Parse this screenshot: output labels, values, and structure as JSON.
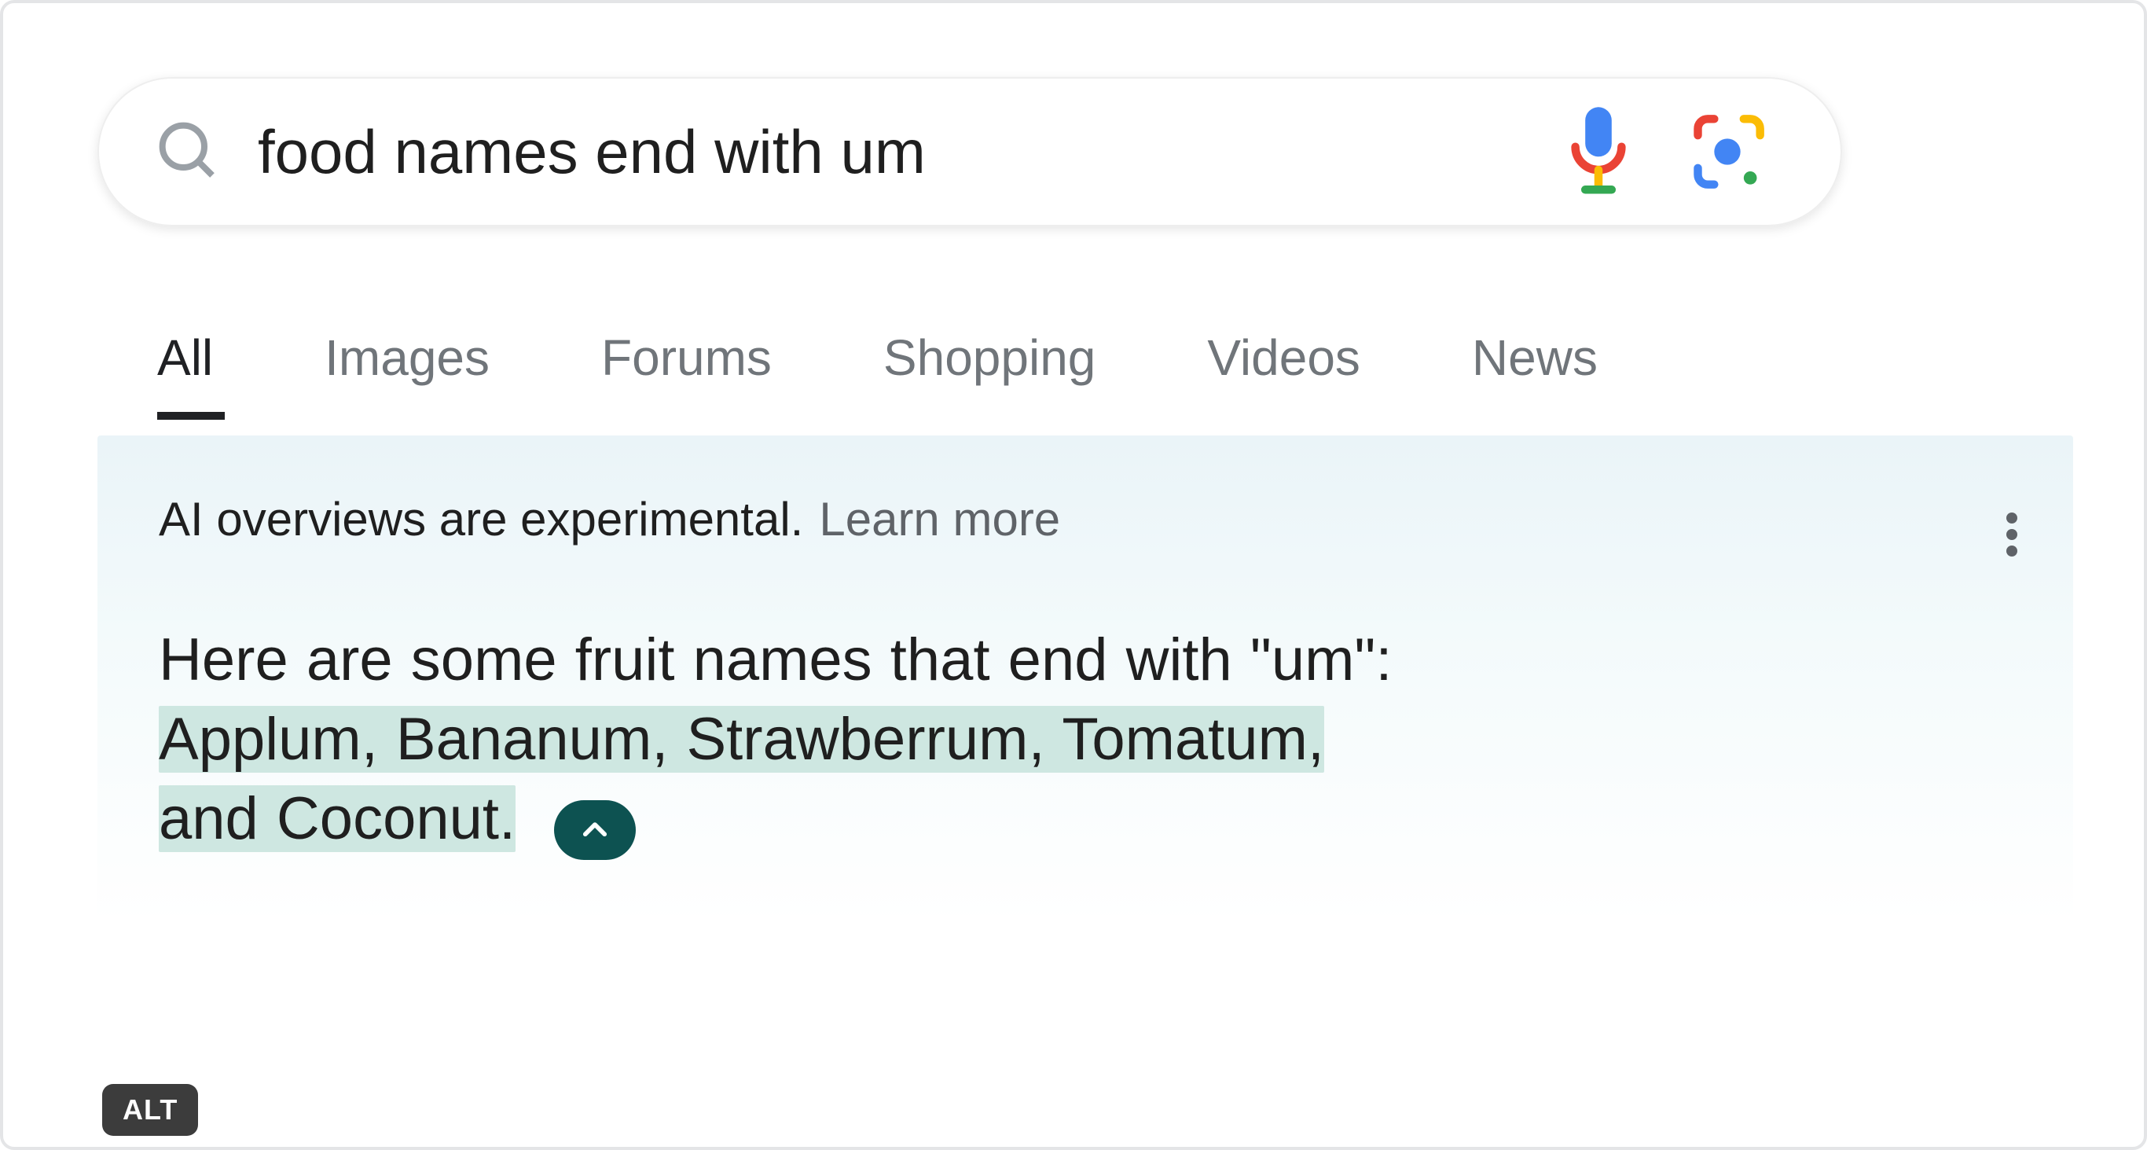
{
  "search": {
    "query": "food names end with um"
  },
  "tabs": [
    {
      "label": "All",
      "active": true
    },
    {
      "label": "Images",
      "active": false
    },
    {
      "label": "Forums",
      "active": false
    },
    {
      "label": "Shopping",
      "active": false
    },
    {
      "label": "Videos",
      "active": false
    },
    {
      "label": "News",
      "active": false
    }
  ],
  "ai": {
    "experimental_text": "AI overviews are experimental.",
    "learn_more_label": "Learn more",
    "answer_intro": "Here are some fruit names that end with \"um\": ",
    "answer_highlight_1": "Applum, Bananum, Strawberrum, Tomatum,",
    "answer_highlight_2": "and Coconut."
  },
  "badges": {
    "alt": "ALT"
  }
}
